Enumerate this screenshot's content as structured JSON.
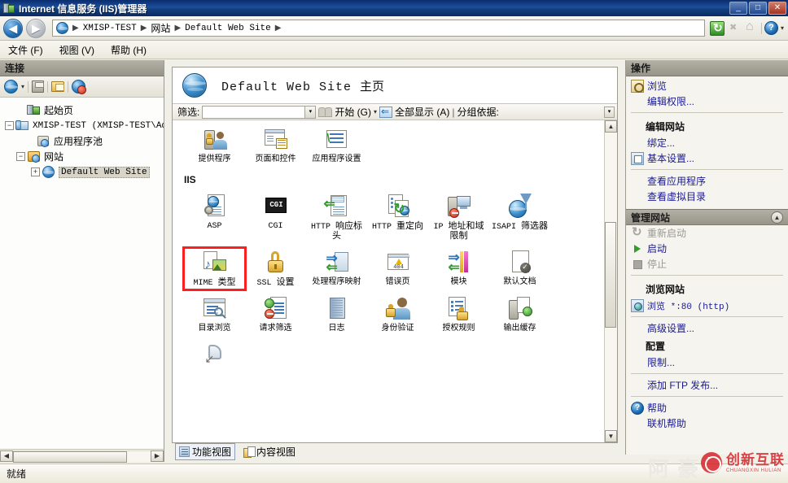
{
  "window": {
    "title": "Internet 信息服务 (IIS)管理器",
    "titlebar_icon": "iis-manager-icon",
    "minimize_label": "_",
    "maximize_label": "□",
    "close_label": "✕"
  },
  "addressbar": {
    "back_label": "◀",
    "forward_label": "▶",
    "globe_icon": "globe-icon",
    "crumbs": [
      "XMISP-TEST",
      "网站",
      "Default Web Site"
    ],
    "separator": "▶",
    "refresh_icon": "refresh-icon",
    "stop_icon": "stop-icon",
    "home_icon": "home-icon",
    "help_icon": "help-icon",
    "dropdown_caret": "▾"
  },
  "menubar": {
    "items": [
      {
        "label": "文件 (F)"
      },
      {
        "label": "视图 (V)"
      },
      {
        "label": "帮助 (H)"
      }
    ]
  },
  "connections": {
    "header": "连接",
    "toolbar": [
      {
        "name": "connect-to-icon",
        "label": ""
      },
      {
        "name": "save-icon",
        "label": ""
      },
      {
        "name": "open-folder-icon",
        "label": ""
      },
      {
        "name": "disconnect-icon",
        "label": ""
      }
    ],
    "toolbar_caret": "▾",
    "tree": [
      {
        "label": "起始页",
        "icon": "start-page-icon",
        "depth": 1,
        "expander": "",
        "selected": false,
        "mono": false
      },
      {
        "label": "XMISP-TEST (XMISP-TEST\\Adm",
        "icon": "server-icon",
        "depth": 0,
        "expander": "−",
        "selected": false,
        "mono": true
      },
      {
        "label": "应用程序池",
        "icon": "app-pool-icon",
        "depth": 2,
        "expander": "",
        "selected": false,
        "mono": false
      },
      {
        "label": "网站",
        "icon": "sites-folder-icon",
        "depth": 1,
        "expander": "−",
        "selected": false,
        "mono": false
      },
      {
        "label": "Default Web Site",
        "icon": "website-icon",
        "depth": 2,
        "expander": "+",
        "selected": true,
        "mono": true
      }
    ],
    "hscroll": {
      "left_label": "◀",
      "right_label": "▶"
    }
  },
  "content": {
    "page_icon": "website-globe-icon",
    "page_title_main": "Default Web Site",
    "page_title_suffix": "主页",
    "filter": {
      "label": "筛选:",
      "value": "",
      "placeholder": "",
      "dropdown_caret": "▾",
      "go_label": "开始 (G)",
      "go_caret": "▾",
      "show_all_label": "全部显示 (A)",
      "separator": "|",
      "group_by_label": "分组依据:",
      "collapse_label": "▾"
    },
    "groups": [
      {
        "title": "",
        "items": [
          {
            "label": "提供程序",
            "icon": "providers-icon"
          },
          {
            "label": "页面和控件",
            "icon": "pages-and-controls-icon"
          },
          {
            "label": "应用程序设置",
            "icon": "application-settings-icon"
          }
        ]
      },
      {
        "title": "IIS",
        "items": [
          {
            "label": "ASP",
            "icon": "asp-icon",
            "mono": true
          },
          {
            "label": "CGI",
            "icon": "cgi-icon",
            "mono": true
          },
          {
            "label": "HTTP 响应标头",
            "icon": "http-response-headers-icon"
          },
          {
            "label": "HTTP 重定向",
            "icon": "http-redirect-icon"
          },
          {
            "label": "IP 地址和域限制",
            "icon": "ip-address-and-domain-restrictions-icon"
          },
          {
            "label": "ISAPI 筛选器",
            "icon": "isapi-filters-icon"
          },
          {
            "label": "MIME 类型",
            "icon": "mime-types-icon",
            "highlighted": true
          },
          {
            "label": "SSL 设置",
            "icon": "ssl-settings-icon"
          },
          {
            "label": "处理程序映射",
            "icon": "handler-mappings-icon"
          },
          {
            "label": "错误页",
            "icon": "error-pages-icon"
          },
          {
            "label": "模块",
            "icon": "modules-icon"
          },
          {
            "label": "默认文档",
            "icon": "default-document-icon"
          },
          {
            "label": "目录浏览",
            "icon": "directory-browsing-icon"
          },
          {
            "label": "请求筛选",
            "icon": "request-filtering-icon"
          },
          {
            "label": "日志",
            "icon": "logging-icon"
          },
          {
            "label": "身份验证",
            "icon": "authentication-icon"
          },
          {
            "label": "授权规则",
            "icon": "authorization-rules-icon"
          },
          {
            "label": "输出缓存",
            "icon": "output-caching-icon"
          },
          {
            "label": "",
            "icon": "worker-processes-icon"
          }
        ]
      }
    ],
    "vscroll": {
      "up_label": "▲",
      "down_label": "▼"
    },
    "view_tabs": [
      {
        "label": "功能视图",
        "icon": "features-view-icon",
        "active": true
      },
      {
        "label": "内容视图",
        "icon": "content-view-icon",
        "active": false
      }
    ]
  },
  "actions": {
    "header": "操作",
    "sections": [
      {
        "type": "plain",
        "items": [
          {
            "label": "浏览",
            "icon": "browse-icon",
            "disabled": false
          },
          {
            "label": "编辑权限...",
            "icon": "",
            "disabled": false
          }
        ]
      },
      {
        "type": "plain",
        "subheading": "编辑网站",
        "items": [
          {
            "label": "绑定...",
            "icon": "",
            "disabled": false
          },
          {
            "label": "基本设置...",
            "icon": "basic-settings-icon",
            "disabled": false
          }
        ]
      },
      {
        "type": "plain",
        "items": [
          {
            "label": "查看应用程序",
            "icon": "",
            "disabled": false
          },
          {
            "label": "查看虚拟目录",
            "icon": "",
            "disabled": false
          }
        ]
      },
      {
        "type": "group",
        "group_title": "管理网站",
        "collapse_label": "▲",
        "items": [
          {
            "label": "重新启动",
            "icon": "restart-icon",
            "disabled": true
          },
          {
            "label": "启动",
            "icon": "start-icon",
            "disabled": false
          },
          {
            "label": "停止",
            "icon": "stop-square-icon",
            "disabled": true
          }
        ]
      },
      {
        "type": "plain",
        "subheading": "浏览网站",
        "items": [
          {
            "label": "浏览 *:80 (http)",
            "icon": "browse-site-icon",
            "disabled": false,
            "mono": true
          }
        ]
      },
      {
        "type": "plain",
        "items": [
          {
            "label": "高级设置...",
            "icon": "",
            "disabled": false
          }
        ]
      },
      {
        "type": "plain",
        "subheading": "配置",
        "items": [
          {
            "label": "限制...",
            "icon": "",
            "disabled": false
          }
        ]
      },
      {
        "type": "plain",
        "items": [
          {
            "label": "添加 FTP 发布...",
            "icon": "",
            "disabled": false,
            "mono": false
          }
        ]
      },
      {
        "type": "plain",
        "items": [
          {
            "label": "帮助",
            "icon": "help-circle-icon",
            "disabled": false
          },
          {
            "label": "联机帮助",
            "icon": "",
            "disabled": false
          }
        ]
      }
    ]
  },
  "statusbar": {
    "text": "就绪"
  },
  "watermark": {
    "brand": "创新互联",
    "sub": "CHUANGXIN HULIAN",
    "mark": "X",
    "ghost": "阿豪"
  },
  "colors": {
    "titlebar": "#13417f",
    "panel_header": "#a29f94",
    "link": "#1a1a8f",
    "highlight_box": "#fb1f1f",
    "disabled_text": "#9a9a93",
    "brand_red": "#d7242a"
  }
}
